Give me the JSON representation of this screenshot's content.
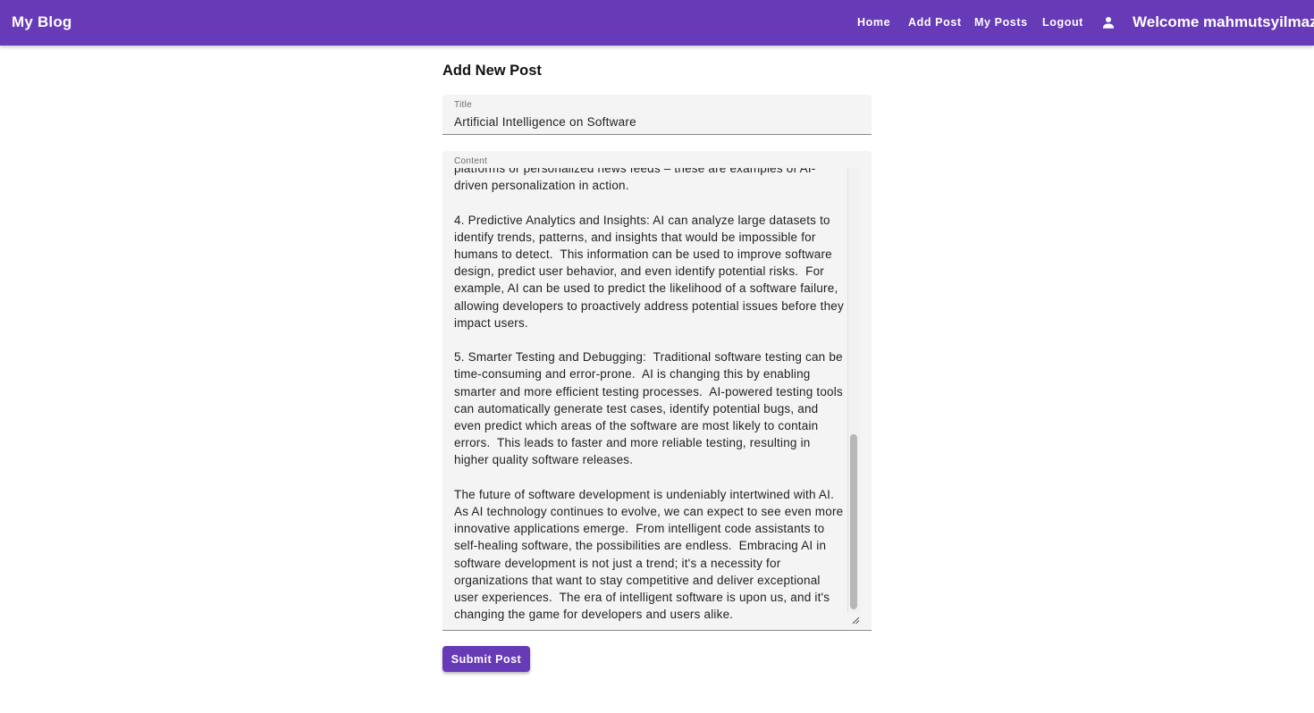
{
  "header": {
    "brand": "My Blog",
    "nav": [
      {
        "label": "Home"
      },
      {
        "label": "Add Post"
      },
      {
        "label": "My Posts"
      },
      {
        "label": "Logout"
      }
    ],
    "user_icon": "person-icon",
    "welcome": "Welcome mahmutsyilmaz"
  },
  "form": {
    "heading": "Add New Post",
    "title_label": "Title",
    "title_value": "Artificial Intelligence on Software",
    "content_label": "Content",
    "content_value": "platforms or personalized news feeds – these are examples of AI-driven personalization in action.\n\n4. Predictive Analytics and Insights: AI can analyze large datasets to identify trends, patterns, and insights that would be impossible for humans to detect.  This information can be used to improve software design, predict user behavior, and even identify potential risks.  For example, AI can be used to predict the likelihood of a software failure, allowing developers to proactively address potential issues before they impact users.\n\n5. Smarter Testing and Debugging:  Traditional software testing can be time-consuming and error-prone.  AI is changing this by enabling smarter and more efficient testing processes.  AI-powered testing tools can automatically generate test cases, identify potential bugs, and even predict which areas of the software are most likely to contain errors.  This leads to faster and more reliable testing, resulting in higher quality software releases.\n\nThe future of software development is undeniably intertwined with AI.  As AI technology continues to evolve, we can expect to see even more innovative applications emerge.  From intelligent code assistants to self-healing software, the possibilities are endless.  Embracing AI in software development is not just a trend; it's a necessity for organizations that want to stay competitive and deliver exceptional user experiences.  The era of intelligent software is upon us, and it's changing the game for developers and users alike.",
    "submit_label": "Submit Post"
  },
  "colors": {
    "primary": "#673ab7",
    "field_bg": "#f4f4f4"
  }
}
